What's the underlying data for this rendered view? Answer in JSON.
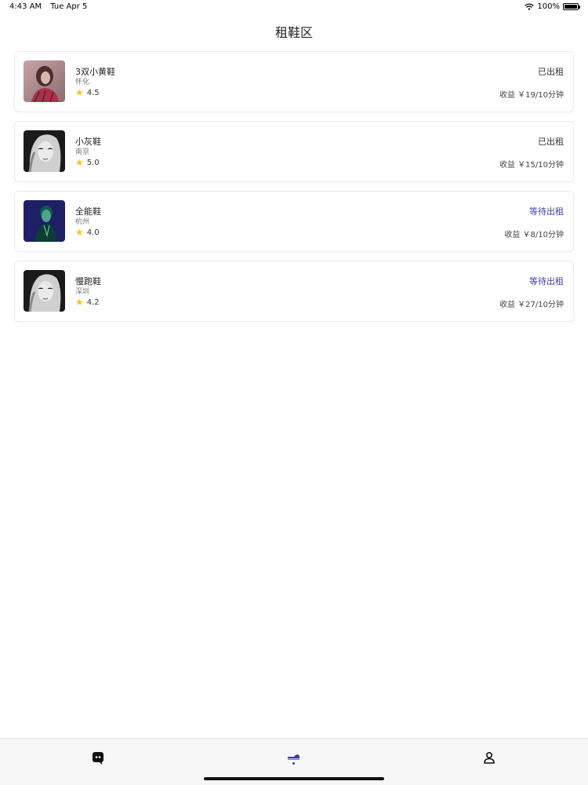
{
  "statusbar": {
    "time": "4:43 AM",
    "date": "Tue Apr 5",
    "battery": "100%"
  },
  "page": {
    "title": "租鞋区"
  },
  "items": [
    {
      "name": "3双小黄鞋",
      "city": "怀化",
      "rating": "4.5",
      "status": "已出租",
      "status_type": "rented",
      "income": "收益 ￥19/10分钟",
      "thumb": "girl-red"
    },
    {
      "name": "小灰鞋",
      "city": "南京",
      "rating": "5.0",
      "status": "已出租",
      "status_type": "rented",
      "income": "收益 ￥15/10分钟",
      "thumb": "girl-bw"
    },
    {
      "name": "全能鞋",
      "city": "杭州",
      "rating": "4.0",
      "status": "等待出租",
      "status_type": "waiting",
      "income": "收益 ￥8/10分钟",
      "thumb": "man-blue"
    },
    {
      "name": "慢跑鞋",
      "city": "深圳",
      "rating": "4.2",
      "status": "等待出租",
      "status_type": "waiting",
      "income": "收益 ￥27/10分钟",
      "thumb": "girl-bw"
    }
  ],
  "tabbar": {
    "tabs": [
      {
        "icon": "chat-icon"
      },
      {
        "icon": "shoe-icon",
        "active": true
      },
      {
        "icon": "user-icon"
      }
    ],
    "accent": "#3f3faa"
  }
}
